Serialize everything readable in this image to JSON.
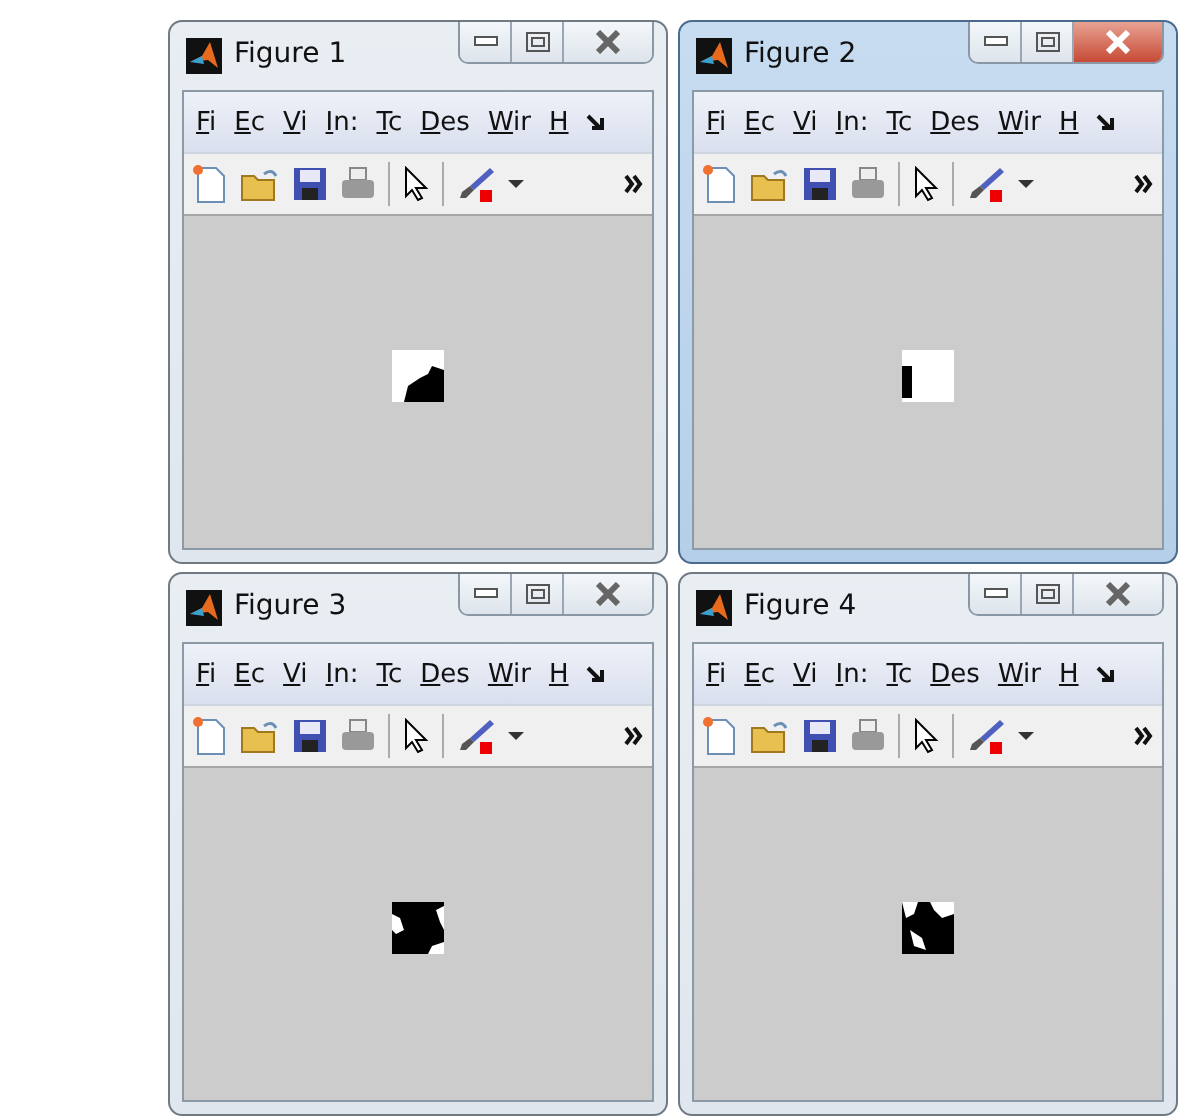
{
  "windows": [
    {
      "title": "Figure 1",
      "active": false,
      "menu": [
        "Fi",
        "Ec",
        "Vi",
        "In:",
        "Tc",
        "Des",
        "Wir",
        "H"
      ]
    },
    {
      "title": "Figure 2",
      "active": true,
      "menu": [
        "Fi",
        "Ec",
        "Vi",
        "In:",
        "Tc",
        "Des",
        "Wir",
        "H"
      ]
    },
    {
      "title": "Figure 3",
      "active": false,
      "menu": [
        "Fi",
        "Ec",
        "Vi",
        "In:",
        "Tc",
        "Des",
        "Wir",
        "H"
      ]
    },
    {
      "title": "Figure 4",
      "active": false,
      "menu": [
        "Fi",
        "Ec",
        "Vi",
        "In:",
        "Tc",
        "Des",
        "Wir",
        "H"
      ]
    }
  ]
}
